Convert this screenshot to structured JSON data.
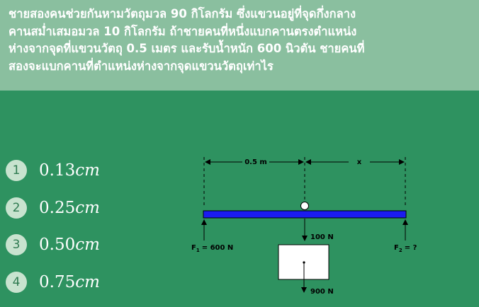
{
  "question": {
    "line1": "ชายสองคนช่วยกันหามวัตถุมวล 90 กิโลกรัม ซึ่งแขวนอยู่ที่จุดกึ่งกลาง",
    "line2": "คานสม่ำเสมอมวล 10 กิโลกรัม ถ้าชายคนที่หนึ่งแบกคานตรงตำแหน่ง",
    "line3": "ห่างจากจุดที่แขวนวัตถุ 0.5 เมตร และรับน้ำหนัก 600 นิวตัน ชายคนที่",
    "line4": "สองจะแบกคานที่ตำแหน่งห่างจากจุดแขวนวัตถุเท่าไร"
  },
  "options": [
    {
      "number": "1",
      "value": "0.13",
      "unit": "cm"
    },
    {
      "number": "2",
      "value": "0.25",
      "unit": "cm"
    },
    {
      "number": "3",
      "value": "0.50",
      "unit": "cm"
    },
    {
      "number": "4",
      "value": "0.75",
      "unit": "cm"
    }
  ],
  "diagram": {
    "dist_left": "0.5 m",
    "dist_right": "x",
    "f1_label": "F",
    "f1_sub": "1",
    "f1_value": "=  600 N",
    "f2_label": "F",
    "f2_sub": "2",
    "f2_value": "=  ?",
    "beam_force": "100 N",
    "weight_force": "900 N"
  },
  "colors": {
    "background": "#2e9260",
    "question_box": "#8abf9f",
    "beam": "#1b1bf0"
  }
}
